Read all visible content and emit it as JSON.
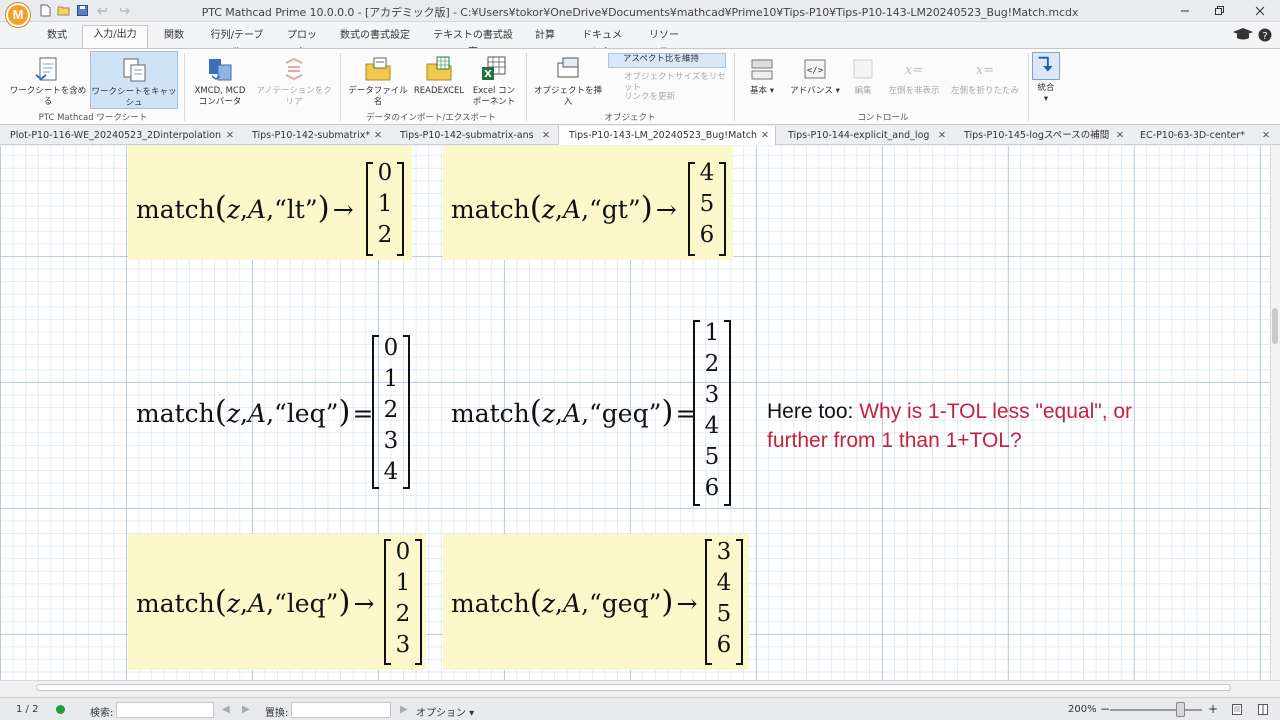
{
  "app": {
    "logo": "M",
    "title": "PTC Mathcad Prime 10.0.0.0 - [アカデミック版] - C:¥Users¥tokor¥OneDrive¥Documents¥mathcad¥Prime10¥Tips-P10¥Tips-P10-143-LM20240523_Bug!Match.mcdx"
  },
  "ribbon_tabs": [
    "数式",
    "入力/出力",
    "関数",
    "行列/テーブル",
    "プロット",
    "数式の書式設定",
    "テキストの書式設定",
    "計算",
    "ドキュメント",
    "リソース"
  ],
  "ribbon": {
    "include_worksheet": "ワークシートを含める",
    "cache_worksheet": "ワークシートをキャッシュ",
    "group_worksheet": "PTC Mathcad ワークシート",
    "xmcd_line1": "XMCD, MCD",
    "xmcd_line2": "コンバータ",
    "clear_annotations": "アノテーションをクリア",
    "data_file_name": "データファイル名",
    "readexcel": "READEXCEL",
    "excel_line1": "Excel コン",
    "excel_line2": "ポーネント",
    "group_data": "データのインポート/エクスポート",
    "insert_object": "オブジェクトを挿入",
    "keep_aspect": "アスペクト比を維持",
    "reset_size": "オブジェクトサイズをリセット",
    "update_link": "リンクを更新",
    "group_object": "オブジェクト",
    "basic": "基本",
    "advanced": "アドバンス",
    "edit": "編集",
    "hide_left": "左側を非表示",
    "collapse_left": "左側を折りたたみ",
    "group_controls": "コントロール",
    "integrate": "統合"
  },
  "doc_tabs": [
    {
      "label": "Plot-P10-116-WE_20240523_2Dinterpolation",
      "close": "✕"
    },
    {
      "label": "Tips-P10-142-submatrix*",
      "close": "✕"
    },
    {
      "label": "Tips-P10-142-submatrix-ans",
      "close": "✕"
    },
    {
      "label": "Tips-P10-143-LM_20240523_Bug!Match",
      "close": "✕"
    },
    {
      "label": "Tips-P10-144-explicit_and_log",
      "close": "✕"
    },
    {
      "label": "Tips-P10-145-logスペースの補間",
      "close": "✕"
    },
    {
      "label": "EC-P10-63-3D-center*",
      "close": "✕"
    }
  ],
  "regions": [
    {
      "fn": "match",
      "args": [
        "z",
        "A",
        "“lt”"
      ],
      "op": "→",
      "result": [
        "0",
        "1",
        "2"
      ]
    },
    {
      "fn": "match",
      "args": [
        "z",
        "A",
        "“gt”"
      ],
      "op": "→",
      "result": [
        "4",
        "5",
        "6"
      ]
    },
    {
      "fn": "match",
      "args": [
        "z",
        "A",
        "“leq”"
      ],
      "op": "=",
      "result": [
        "0",
        "1",
        "2",
        "3",
        "4"
      ]
    },
    {
      "fn": "match",
      "args": [
        "z",
        "A",
        "“geq”"
      ],
      "op": "=",
      "result": [
        "1",
        "2",
        "3",
        "4",
        "5",
        "6"
      ]
    },
    {
      "fn": "match",
      "args": [
        "z",
        "A",
        "“leq”"
      ],
      "op": "→",
      "result": [
        "0",
        "1",
        "2",
        "3"
      ]
    },
    {
      "fn": "match",
      "args": [
        "z",
        "A",
        "“geq”"
      ],
      "op": "→",
      "result": [
        "3",
        "4",
        "5",
        "6"
      ]
    }
  ],
  "note": {
    "prefix": "Here too: ",
    "line1": "Why is 1-TOL less \"equal\", or",
    "line2": "further from 1 than 1+TOL?"
  },
  "status": {
    "page": "1 / 2",
    "search_label": "検索:",
    "search_value": "",
    "replace_label": "置換:",
    "replace_value": "",
    "options": "オプション",
    "zoom": "200%"
  },
  "colors": {
    "region_bg": "#fdf8cc",
    "note_red": "#c4233f",
    "logo": "#f2a22a"
  }
}
